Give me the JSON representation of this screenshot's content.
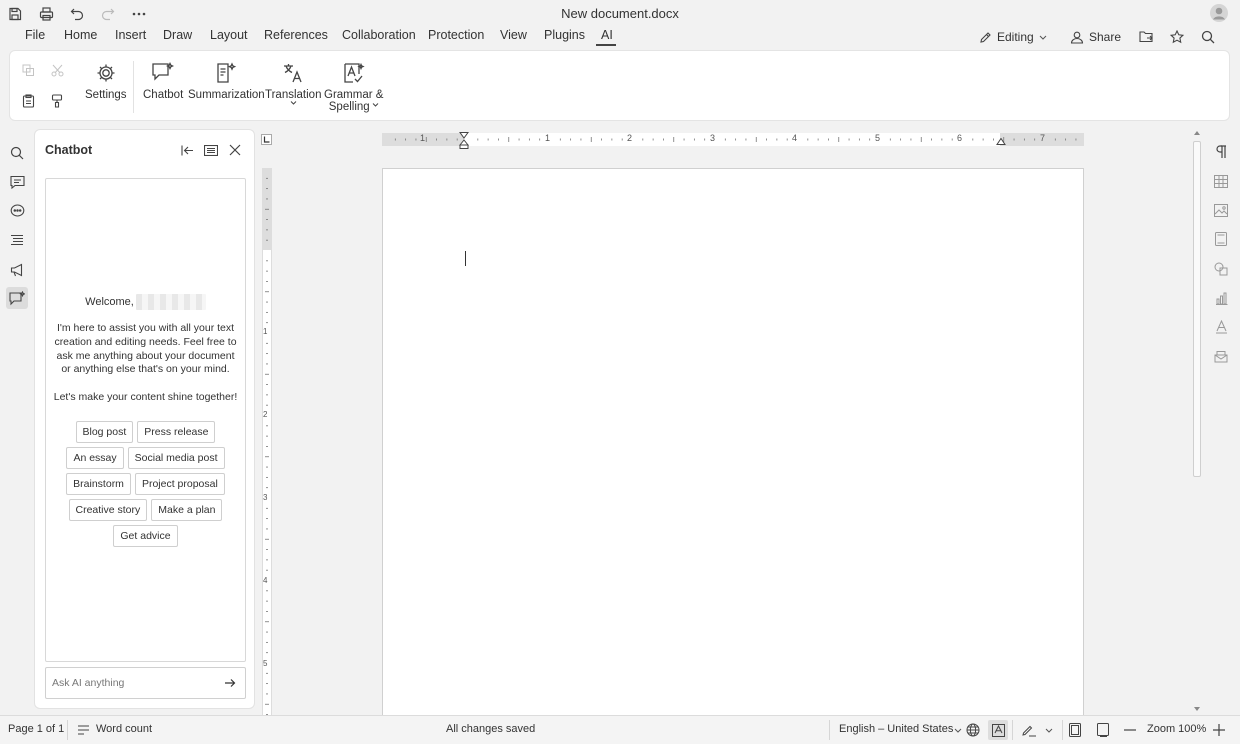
{
  "window": {
    "title": "New document.docx"
  },
  "quick_access": [
    {
      "name": "save-icon"
    },
    {
      "name": "print-icon"
    },
    {
      "name": "undo-icon"
    },
    {
      "name": "redo-icon"
    },
    {
      "name": "more-icon"
    }
  ],
  "menu": {
    "file": "File",
    "home": "Home",
    "insert": "Insert",
    "draw": "Draw",
    "layout": "Layout",
    "references": "References",
    "collaboration": "Collaboration",
    "protection": "Protection",
    "view": "View",
    "plugins": "Plugins",
    "ai": "AI",
    "active": "AI"
  },
  "top_right": {
    "editing": "Editing",
    "share": "Share"
  },
  "ribbon": {
    "settings": "Settings",
    "chatbot": "Chatbot",
    "summarization": "Summarization",
    "translation": "Translation",
    "grammar_line1": "Grammar &",
    "grammar_line2": "Spelling"
  },
  "chatbot": {
    "title": "Chatbot",
    "welcome": "Welcome,",
    "message": "I'm here to assist you with all your text creation and editing needs. Feel free to ask me anything about your document or anything else that's on your mind.",
    "message2": "Let's make your content shine together!",
    "suggestions": [
      "Blog post",
      "Press release",
      "An essay",
      "Social media post",
      "Brainstorm",
      "Project proposal",
      "Creative story",
      "Make a plan",
      "Get advice"
    ],
    "input_placeholder": "Ask AI anything"
  },
  "ruler": {
    "h_numbers": [
      "1",
      "1",
      "2",
      "3",
      "4",
      "5",
      "6",
      "7"
    ],
    "v_numbers": [
      "1",
      "2",
      "3",
      "4",
      "5"
    ]
  },
  "status": {
    "page": "Page 1 of 1",
    "word_count": "Word count",
    "saved": "All changes saved",
    "language": "English – United States",
    "zoom": "Zoom 100%"
  },
  "colors": {
    "accent": "#444444",
    "ribbon_bg": "#ffffff",
    "app_bg": "#f2f2f2"
  }
}
